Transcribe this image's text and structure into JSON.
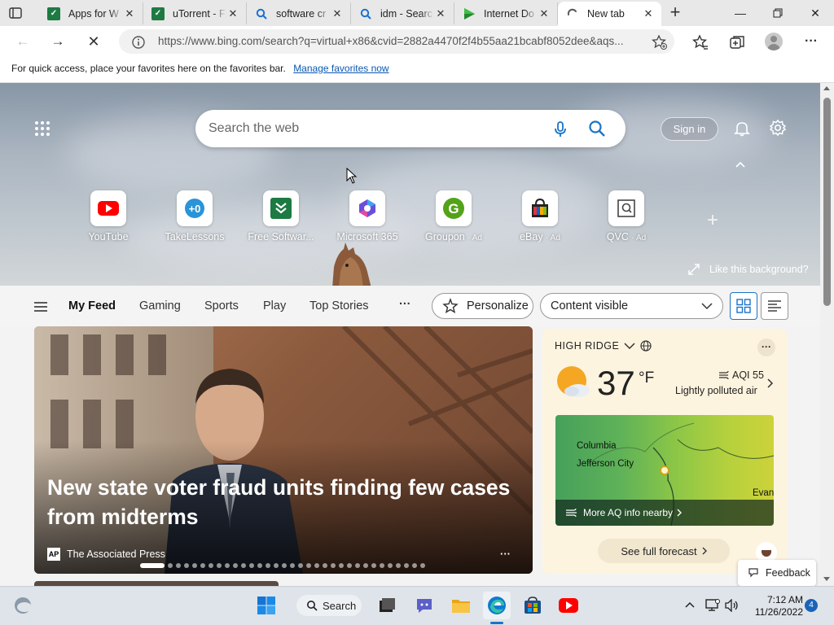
{
  "tabs": [
    {
      "title": "Apps for W",
      "icon": "spreadsheet-icon"
    },
    {
      "title": "uTorrent - F",
      "icon": "spreadsheet-icon"
    },
    {
      "title": "software cr",
      "icon": "search-icon"
    },
    {
      "title": "idm - Searc",
      "icon": "search-icon"
    },
    {
      "title": "Internet Do",
      "icon": "play-icon"
    },
    {
      "title": "New tab",
      "icon": "loading-icon"
    }
  ],
  "address": {
    "url": "https://www.bing.com/search?q=virtual+x86&cvid=2882a4470f2f4b55aa21bcabf8052dee&aqs..."
  },
  "favorites_hint": {
    "text": "For quick access, place your favorites here on the favorites bar.",
    "link": "Manage favorites now"
  },
  "search": {
    "placeholder": "Search the web"
  },
  "header": {
    "signin": "Sign in"
  },
  "quick_links": [
    {
      "label": "YouTube",
      "ad": ""
    },
    {
      "label": "TakeLessons",
      "ad": ""
    },
    {
      "label": "Free Softwar...",
      "ad": ""
    },
    {
      "label": "Microsoft 365",
      "ad": ""
    },
    {
      "label": "Groupon",
      "ad": "· Ad"
    },
    {
      "label": "eBay",
      "ad": "· Ad"
    },
    {
      "label": "QVC",
      "ad": "· Ad"
    }
  ],
  "background": {
    "like_text": "Like this background?"
  },
  "feed_nav": {
    "items": [
      "My Feed",
      "Gaming",
      "Sports",
      "Play",
      "Top Stories"
    ],
    "more": "···",
    "personalize": "Personalize",
    "content_visible": "Content visible"
  },
  "news": {
    "headline": "New state voter fraud units finding few cases from midterms",
    "source": "The Associated Press",
    "source_badge": "AP",
    "more": "···"
  },
  "weather": {
    "location": "HIGH RIDGE",
    "temperature": "37",
    "unit": "°F",
    "aqi": "AQI 55",
    "air": "Lightly polluted air",
    "map_labels": [
      "Columbia",
      "Jefferson City",
      "Evans"
    ],
    "aq_link": "More AQ info nearby",
    "forecast_btn": "See full forecast",
    "more": "···"
  },
  "feedback": "Feedback",
  "taskbar": {
    "search_label": "Search",
    "time": "7:12 AM",
    "date": "11/26/2022",
    "notification_count": "4"
  },
  "colors": {
    "accent": "#0b57b0",
    "edge_blue": "#1a73c8"
  }
}
